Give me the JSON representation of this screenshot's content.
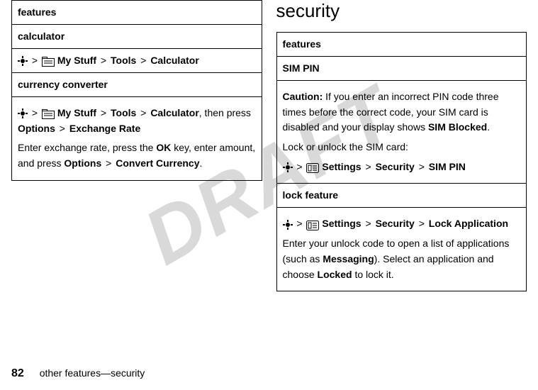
{
  "watermark": "DRAFT",
  "left": {
    "header": "features",
    "rows": [
      {
        "title": "calculator"
      },
      {
        "path": {
          "a": "My Stuff",
          "b": "Tools",
          "c": "Calculator"
        }
      },
      {
        "title": "currency converter"
      },
      {
        "path": {
          "a": "My Stuff",
          "b": "Tools",
          "c": "Calculator"
        },
        "tail1": ", then press ",
        "opt1": "Options",
        "opt2": "Exchange Rate",
        "body1a": "Enter exchange rate, press the ",
        "ok": "OK",
        "body1b": " key, enter amount, and press ",
        "opt3": "Options",
        "opt4": "Convert Currency",
        "body1c": "."
      }
    ]
  },
  "right": {
    "sectionTitle": "security",
    "header": "features",
    "rows": [
      {
        "title": "SIM PIN"
      },
      {
        "cautionLabel": "Caution:",
        "cautionBody1": " If you enter an incorrect PIN code three times before the correct code, your SIM card is disabled and your display shows ",
        "simBlocked": "SIM Blocked",
        "cautionBody2": ".",
        "lockLine": "Lock or unlock the SIM card:",
        "path": {
          "a": "Settings",
          "b": "Security",
          "c": "SIM PIN"
        }
      },
      {
        "title": "lock feature"
      },
      {
        "path": {
          "a": "Settings",
          "b": "Security",
          "c": "Lock Application"
        },
        "body1": "Enter your unlock code to open a list of applications (such as ",
        "msg": "Messaging",
        "body2": "). Select an application and choose ",
        "locked": "Locked",
        "body3": " to lock it."
      }
    ]
  },
  "footer": {
    "page": "82",
    "text": "other features—security"
  }
}
